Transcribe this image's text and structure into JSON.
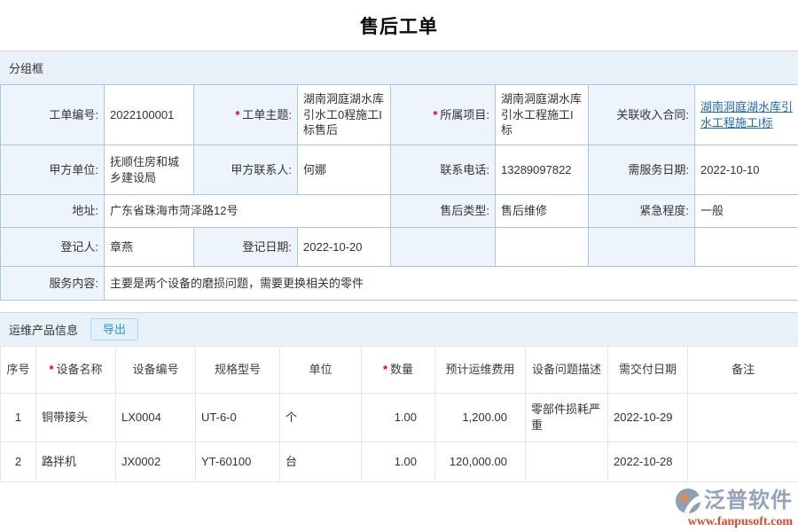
{
  "meta": {
    "required_marker": "*"
  },
  "page": {
    "title": "售后工单"
  },
  "sections": {
    "group_box_label": "分组框",
    "product_section_label": "运维产品信息",
    "export_button_label": "导出"
  },
  "form": {
    "work_order_no": {
      "label": "工单编号:",
      "value": "2022100001"
    },
    "subject": {
      "label": "工单主题:",
      "value": "湖南洞庭湖水库引水工0程施工I标售后"
    },
    "project": {
      "label": "所属项目:",
      "value": "湖南洞庭湖水库引水工程施工I标"
    },
    "income_contract": {
      "label": "关联收入合同:",
      "value": "湖南洞庭湖水库引水工程施工I标"
    },
    "party_a_unit": {
      "label": "甲方单位:",
      "value": "抚顺住房和城乡建设局"
    },
    "party_a_contact": {
      "label": "甲方联系人:",
      "value": "何娜"
    },
    "phone": {
      "label": "联系电话:",
      "value": "13289097822"
    },
    "service_date": {
      "label": "需服务日期:",
      "value": "2022-10-10"
    },
    "address": {
      "label": "地址:",
      "value": "广东省珠海市菏泽路12号"
    },
    "aftersales_type": {
      "label": "售后类型:",
      "value": "售后维修"
    },
    "urgency": {
      "label": "紧急程度:",
      "value": "一般"
    },
    "registrant": {
      "label": "登记人:",
      "value": "章燕"
    },
    "register_date": {
      "label": "登记日期:",
      "value": "2022-10-20"
    },
    "service_content": {
      "label": "服务内容:",
      "value": "主要是两个设备的磨损问题，需要更换相关的零件"
    }
  },
  "product_table": {
    "headers": [
      {
        "label": "序号",
        "required": false
      },
      {
        "label": "设备名称",
        "required": true
      },
      {
        "label": "设备编号",
        "required": false
      },
      {
        "label": "规格型号",
        "required": false
      },
      {
        "label": "单位",
        "required": false
      },
      {
        "label": "数量",
        "required": true
      },
      {
        "label": "预计运维费用",
        "required": false
      },
      {
        "label": "设备问题描述",
        "required": false
      },
      {
        "label": "需交付日期",
        "required": false
      },
      {
        "label": "备注",
        "required": false
      }
    ],
    "rows": [
      [
        "1",
        "铜带接头",
        "LX0004",
        "UT-6-0",
        "个",
        "1.00",
        "1,200.00",
        "零部件损耗严重",
        "2022-10-29",
        ""
      ],
      [
        "2",
        "路拌机",
        "JX0002",
        "YT-60100",
        "台",
        "1.00",
        "120,000.00",
        "",
        "2022-10-28",
        ""
      ]
    ]
  },
  "footer": {
    "brand": "泛普软件",
    "website": "www.fanpusoft.com"
  }
}
